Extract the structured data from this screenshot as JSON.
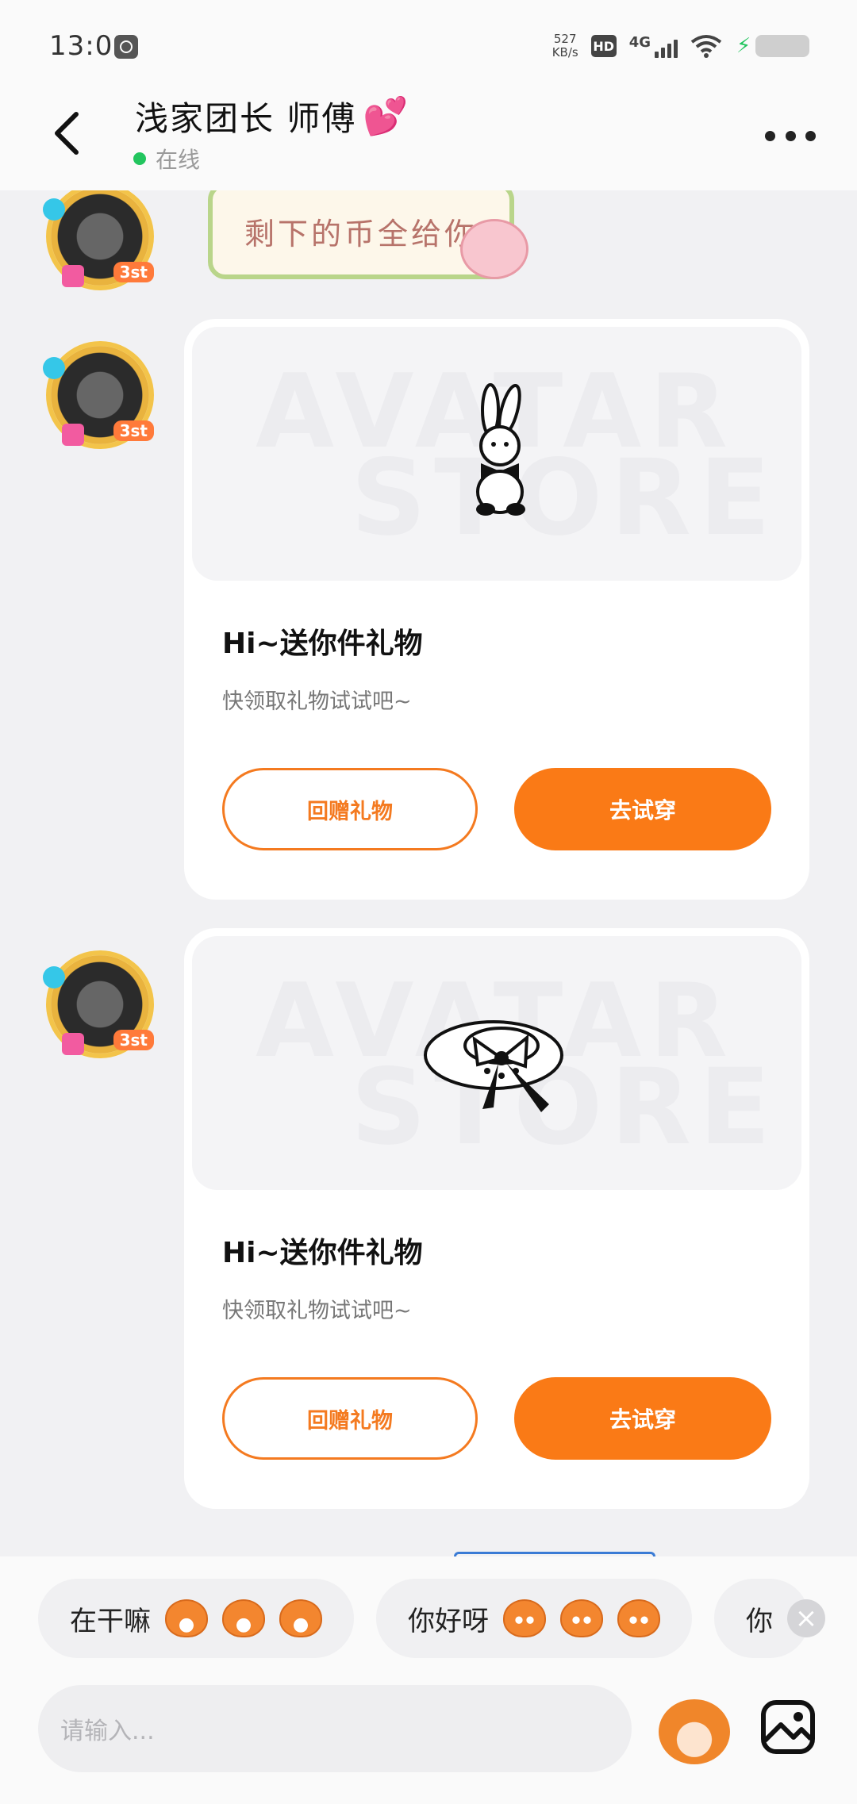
{
  "status_bar": {
    "time": "13:01",
    "net_speed_value": "527",
    "net_speed_unit": "KB/s",
    "hd_label": "HD",
    "network_label": "4G"
  },
  "header": {
    "title": "浅家团长 师傅",
    "title_emoji": "💕",
    "status_text": "在线"
  },
  "messages": [
    {
      "type": "sticker",
      "sticker_text": "剩下的币全给你"
    },
    {
      "type": "gift_card",
      "image": "bunny",
      "title": "Hi~送你件礼物",
      "desc": "快领取礼物试试吧~",
      "secondary_label": "回赠礼物",
      "primary_label": "去试穿"
    },
    {
      "type": "gift_card",
      "image": "hat",
      "title": "Hi~送你件礼物",
      "desc": "快领取礼物试试吧~",
      "secondary_label": "回赠礼物",
      "primary_label": "去试穿"
    }
  ],
  "avatar_badge": "3st",
  "watermark": {
    "line1": "AVATAR",
    "line2": "STORE"
  },
  "quick_replies": [
    {
      "label": "在干嘛"
    },
    {
      "label": "你好呀"
    },
    {
      "label": "你"
    }
  ],
  "input": {
    "placeholder": "请输入..."
  },
  "colors": {
    "accent": "#fa7a16",
    "online": "#22c55e",
    "background": "#f1f1f3"
  }
}
